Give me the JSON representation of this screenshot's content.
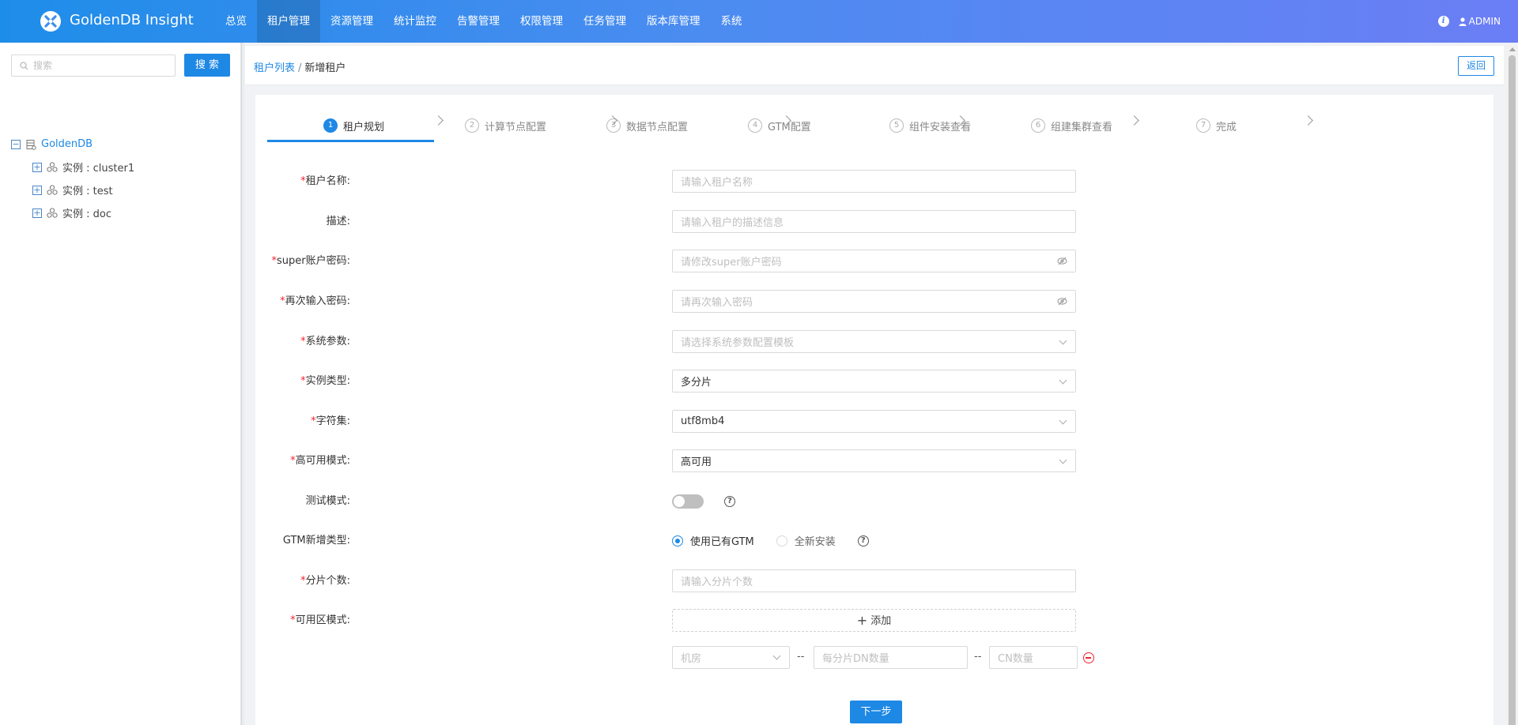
{
  "app": {
    "brand": "GoldenDB Insight",
    "user": "ADMIN"
  },
  "nav": [
    "总览",
    "租户管理",
    "资源管理",
    "统计监控",
    "告警管理",
    "权限管理",
    "任务管理",
    "版本库管理",
    "系统"
  ],
  "nav_active": "租户管理",
  "sidebar": {
    "search_placeholder": "搜索",
    "search_button": "搜 索",
    "tree_root": "GoldenDB",
    "tree_children": [
      "实例 : cluster1",
      "实例 : test",
      "实例 : doc"
    ]
  },
  "breadcrumb": {
    "link": "租户列表",
    "separator": "/",
    "current": "新增租户"
  },
  "back_button": "返回",
  "steps": [
    {
      "num": "1",
      "label": "租户规划",
      "active": true
    },
    {
      "num": "2",
      "label": "计算节点配置",
      "active": false
    },
    {
      "num": "3",
      "label": "数据节点配置",
      "active": false
    },
    {
      "num": "4",
      "label": "GTM配置",
      "active": false
    },
    {
      "num": "5",
      "label": "组件安装查看",
      "active": false
    },
    {
      "num": "6",
      "label": "组建集群查看",
      "active": false
    },
    {
      "num": "7",
      "label": "完成",
      "active": false
    }
  ],
  "form": {
    "tenant_name": {
      "label": "租户名称:",
      "required": true,
      "placeholder": "请输入租户名称"
    },
    "description": {
      "label": "描述:",
      "required": false,
      "placeholder": "请输入租户的描述信息"
    },
    "super_password": {
      "label": "super账户密码:",
      "required": true,
      "placeholder": "请修改super账户密码"
    },
    "confirm_password": {
      "label": "再次输入密码:",
      "required": true,
      "placeholder": "请再次输入密码"
    },
    "system_params": {
      "label": "系统参数:",
      "required": true,
      "placeholder": "请选择系统参数配置模板"
    },
    "instance_type": {
      "label": "实例类型:",
      "required": true,
      "value": "多分片"
    },
    "charset": {
      "label": "字符集:",
      "required": true,
      "value": "utf8mb4"
    },
    "ha_mode": {
      "label": "高可用模式:",
      "required": true,
      "value": "高可用"
    },
    "test_mode": {
      "label": "测试模式:",
      "required": false,
      "enabled": false
    },
    "gtm_type": {
      "label": "GTM新增类型:",
      "required": false,
      "options": [
        "使用已有GTM",
        "全新安装"
      ],
      "selected": "使用已有GTM"
    },
    "shard_count": {
      "label": "分片个数:",
      "required": true,
      "placeholder": "请输入分片个数"
    },
    "az_mode": {
      "label": "可用区模式:",
      "required": true,
      "add_label": "添加"
    },
    "az_row": {
      "room_placeholder": "机房",
      "dn_placeholder": "每分片DN数量",
      "cn_placeholder": "CN数量",
      "separator": "--"
    }
  },
  "next_button": "下一步",
  "colors": {
    "primary": "#1e88e5",
    "required": "#f5222d",
    "header_start": "#1e8de9",
    "header_end": "#6b7ef5"
  }
}
